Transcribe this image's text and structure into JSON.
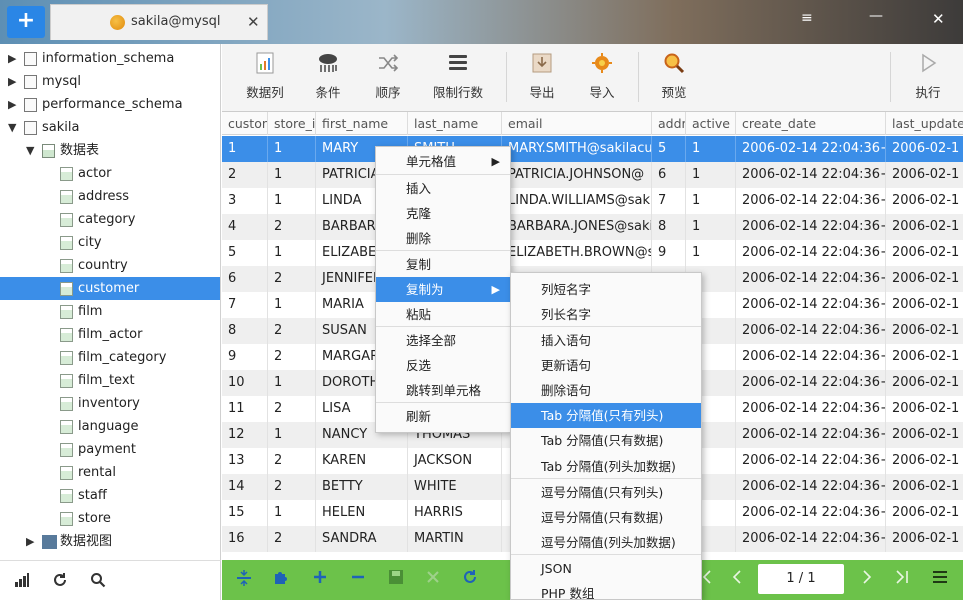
{
  "titlebar": {
    "add_label": "+",
    "tab_label": "sakila@mysql",
    "close_label": "✕",
    "menu_glyph": "≡",
    "min_glyph": "—",
    "win_close_glyph": "✕"
  },
  "tree": [
    {
      "label": "information_schema",
      "level": 0,
      "arrow": "▶",
      "icon": "db"
    },
    {
      "label": "mysql",
      "level": 0,
      "arrow": "▶",
      "icon": "db"
    },
    {
      "label": "performance_schema",
      "level": 0,
      "arrow": "▶",
      "icon": "db"
    },
    {
      "label": "sakila",
      "level": 0,
      "arrow": "▼",
      "icon": "db"
    },
    {
      "label": "数据表",
      "level": 1,
      "arrow": "▼",
      "icon": "grp"
    },
    {
      "label": "actor",
      "level": 2,
      "arrow": "",
      "icon": "tbl"
    },
    {
      "label": "address",
      "level": 2,
      "arrow": "",
      "icon": "tbl"
    },
    {
      "label": "category",
      "level": 2,
      "arrow": "",
      "icon": "tbl"
    },
    {
      "label": "city",
      "level": 2,
      "arrow": "",
      "icon": "tbl"
    },
    {
      "label": "country",
      "level": 2,
      "arrow": "",
      "icon": "tbl"
    },
    {
      "label": "customer",
      "level": 2,
      "arrow": "",
      "icon": "tbl",
      "selected": true
    },
    {
      "label": "film",
      "level": 2,
      "arrow": "",
      "icon": "tbl"
    },
    {
      "label": "film_actor",
      "level": 2,
      "arrow": "",
      "icon": "tbl"
    },
    {
      "label": "film_category",
      "level": 2,
      "arrow": "",
      "icon": "tbl"
    },
    {
      "label": "film_text",
      "level": 2,
      "arrow": "",
      "icon": "tbl"
    },
    {
      "label": "inventory",
      "level": 2,
      "arrow": "",
      "icon": "tbl"
    },
    {
      "label": "language",
      "level": 2,
      "arrow": "",
      "icon": "tbl"
    },
    {
      "label": "payment",
      "level": 2,
      "arrow": "",
      "icon": "tbl"
    },
    {
      "label": "rental",
      "level": 2,
      "arrow": "",
      "icon": "tbl"
    },
    {
      "label": "staff",
      "level": 2,
      "arrow": "",
      "icon": "tbl"
    },
    {
      "label": "store",
      "level": 2,
      "arrow": "",
      "icon": "tbl"
    },
    {
      "label": "数据视图",
      "level": 1,
      "arrow": "▶",
      "icon": "view"
    }
  ],
  "sidebar_bottom": {
    "signal_icon": "signal-icon",
    "refresh_icon": "refresh-icon",
    "search_icon": "search-icon"
  },
  "toolbar": {
    "columns": "数据列",
    "filter": "条件",
    "order": "顺序",
    "limit": "限制行数",
    "export": "导出",
    "import": "导入",
    "preview": "预览",
    "execute": "执行"
  },
  "grid": {
    "headers": [
      "custon",
      "store_i",
      "first_name",
      "last_name",
      "email",
      "addr",
      "active",
      "create_date",
      "last_update"
    ],
    "rows": [
      [
        "1",
        "1",
        "MARY",
        "SMITH",
        "MARY.SMITH@sakilacu",
        "5",
        "1",
        "2006-02-14 22:04:36+",
        "2006-02-1"
      ],
      [
        "2",
        "1",
        "PATRICIA",
        "",
        "PATRICIA.JOHNSON@",
        "6",
        "1",
        "2006-02-14 22:04:36+",
        "2006-02-1"
      ],
      [
        "3",
        "1",
        "LINDA",
        "",
        "LINDA.WILLIAMS@sak",
        "7",
        "1",
        "2006-02-14 22:04:36+",
        "2006-02-1"
      ],
      [
        "4",
        "2",
        "BARBARA",
        "",
        "BARBARA.JONES@saki",
        "8",
        "1",
        "2006-02-14 22:04:36+",
        "2006-02-1"
      ],
      [
        "5",
        "1",
        "ELIZABETH",
        "",
        "ELIZABETH.BROWN@s",
        "9",
        "1",
        "2006-02-14 22:04:36+",
        "2006-02-1"
      ],
      [
        "6",
        "2",
        "JENNIFER",
        "",
        "",
        "",
        "",
        "2006-02-14 22:04:36+",
        "2006-02-1"
      ],
      [
        "7",
        "1",
        "MARIA",
        "",
        "",
        "",
        "",
        "2006-02-14 22:04:36+",
        "2006-02-1"
      ],
      [
        "8",
        "2",
        "SUSAN",
        "",
        "",
        "",
        "",
        "2006-02-14 22:04:36+",
        "2006-02-1"
      ],
      [
        "9",
        "2",
        "MARGARET",
        "",
        "",
        "",
        "",
        "2006-02-14 22:04:36+",
        "2006-02-1"
      ],
      [
        "10",
        "1",
        "DOROTHY",
        "",
        "",
        "",
        "",
        "2006-02-14 22:04:36+",
        "2006-02-1"
      ],
      [
        "11",
        "2",
        "LISA",
        "",
        "",
        "",
        "",
        "2006-02-14 22:04:36+",
        "2006-02-1"
      ],
      [
        "12",
        "1",
        "NANCY",
        "THOMAS",
        "",
        "",
        "",
        "2006-02-14 22:04:36+",
        "2006-02-1"
      ],
      [
        "13",
        "2",
        "KAREN",
        "JACKSON",
        "",
        "",
        "",
        "2006-02-14 22:04:36+",
        "2006-02-1"
      ],
      [
        "14",
        "2",
        "BETTY",
        "WHITE",
        "",
        "",
        "",
        "2006-02-14 22:04:36+",
        "2006-02-1"
      ],
      [
        "15",
        "1",
        "HELEN",
        "HARRIS",
        "",
        "",
        "",
        "2006-02-14 22:04:36+",
        "2006-02-1"
      ],
      [
        "16",
        "2",
        "SANDRA",
        "MARTIN",
        "",
        "",
        "",
        "2006-02-14 22:04:36+",
        "2006-02-1"
      ]
    ]
  },
  "context_menu": {
    "items": [
      "单元格值",
      "插入",
      "克隆",
      "删除",
      "复制",
      "复制为",
      "粘贴",
      "选择全部",
      "反选",
      "跳转到单元格",
      "刷新"
    ],
    "submenu_arrow": "▶"
  },
  "submenu": {
    "items": [
      "列短名字",
      "列长名字",
      "插入语句",
      "更新语句",
      "删除语句",
      "Tab 分隔值(只有列头)",
      "Tab 分隔值(只有数据)",
      "Tab 分隔值(列头加数据)",
      "逗号分隔值(只有列头)",
      "逗号分隔值(只有数据)",
      "逗号分隔值(列头加数据)",
      "JSON",
      "PHP 数组"
    ]
  },
  "bottombar": {
    "page": "1 / 1"
  },
  "colors": {
    "accent": "#3b8ee8",
    "bottom_bar": "#6cc24a",
    "add_button": "#2a86e6"
  }
}
